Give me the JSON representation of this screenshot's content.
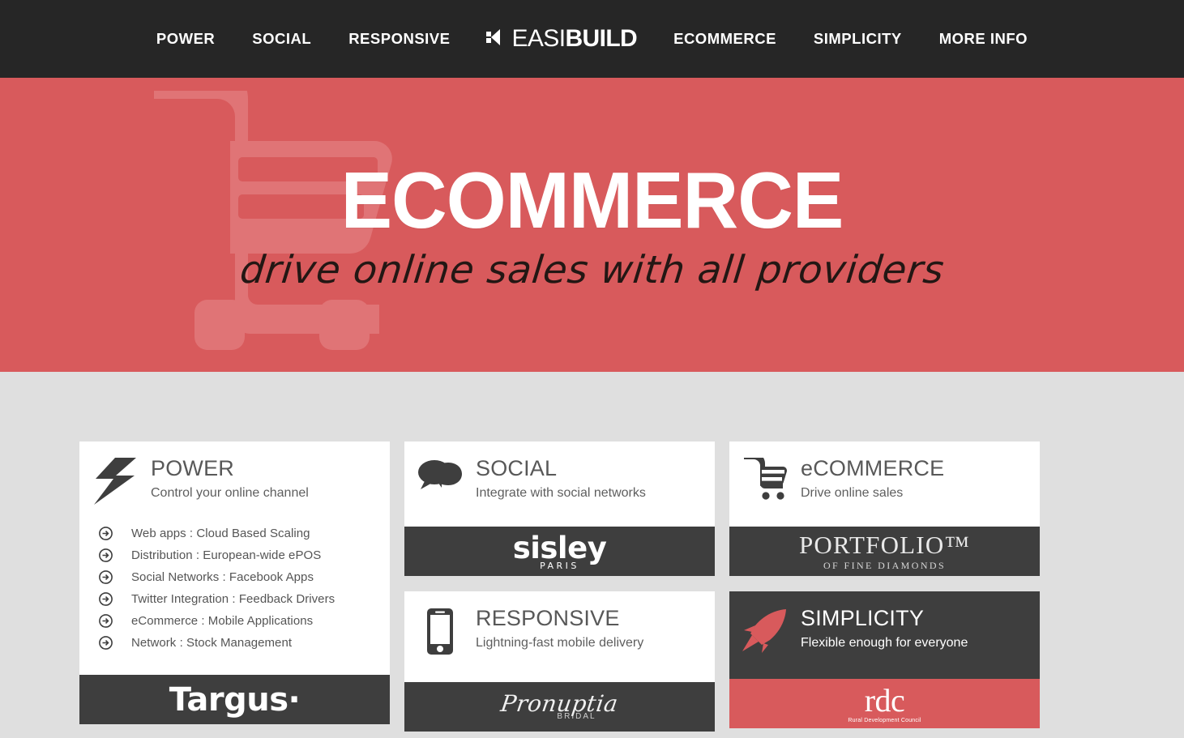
{
  "nav": {
    "items": [
      {
        "label": "POWER"
      },
      {
        "label": "SOCIAL"
      },
      {
        "label": "RESPONSIVE"
      }
    ],
    "brand": {
      "easi": "EASI",
      "build": "BUILD",
      "mark": "easibuild-logo-mark"
    },
    "items_right": [
      {
        "label": "ECOMMERCE"
      },
      {
        "label": "SIMPLICITY"
      },
      {
        "label": "MORE INFO"
      }
    ]
  },
  "hero": {
    "title": "ECOMMERCE",
    "subtitle": "drive online sales with all providers",
    "background_color": "#d85a5c",
    "watermark": "shopping-cart-watermark"
  },
  "colors": {
    "accent_red": "#d85a5c",
    "dark": "#262626",
    "card_dark": "#3e3e3e",
    "page_background": "#dfdfdf",
    "card_white": "#ffffff"
  },
  "cards": {
    "power": {
      "icon": "lightning-bolt-icon",
      "title": "POWER",
      "subtitle": "Control your online channel",
      "features": [
        "Web apps : Cloud Based Scaling",
        "Distribution : European-wide ePOS",
        "Social Networks : Facebook Apps",
        "Twitter Integration : Feedback Drivers",
        "eCommerce : Mobile Applications",
        "Network : Stock Management"
      ],
      "logo": {
        "name": "Targus",
        "mark": "registered-dot"
      }
    },
    "social": {
      "icon": "speech-bubbles-icon",
      "title": "SOCIAL",
      "subtitle": "Integrate with social networks",
      "logo": {
        "name": "sisley",
        "sub": "PARIS"
      }
    },
    "ecommerce": {
      "icon": "shopping-cart-icon",
      "title": "eCOMMERCE",
      "subtitle": "Drive online sales",
      "logo": {
        "name": "PORTFOLIO",
        "tm": "™",
        "sub": "OF FINE DIAMONDS"
      }
    },
    "responsive": {
      "icon": "mobile-phone-icon",
      "title": "RESPONSIVE",
      "subtitle": "Lightning-fast mobile delivery",
      "logo": {
        "name": "Pronuptia",
        "sub": "BRIDAL"
      }
    },
    "simplicity": {
      "icon": "rocket-icon",
      "title": "SIMPLICITY",
      "subtitle": "Flexible enough for everyone",
      "logo": {
        "name": "rdc",
        "sub": "Rural Development Council"
      }
    }
  }
}
